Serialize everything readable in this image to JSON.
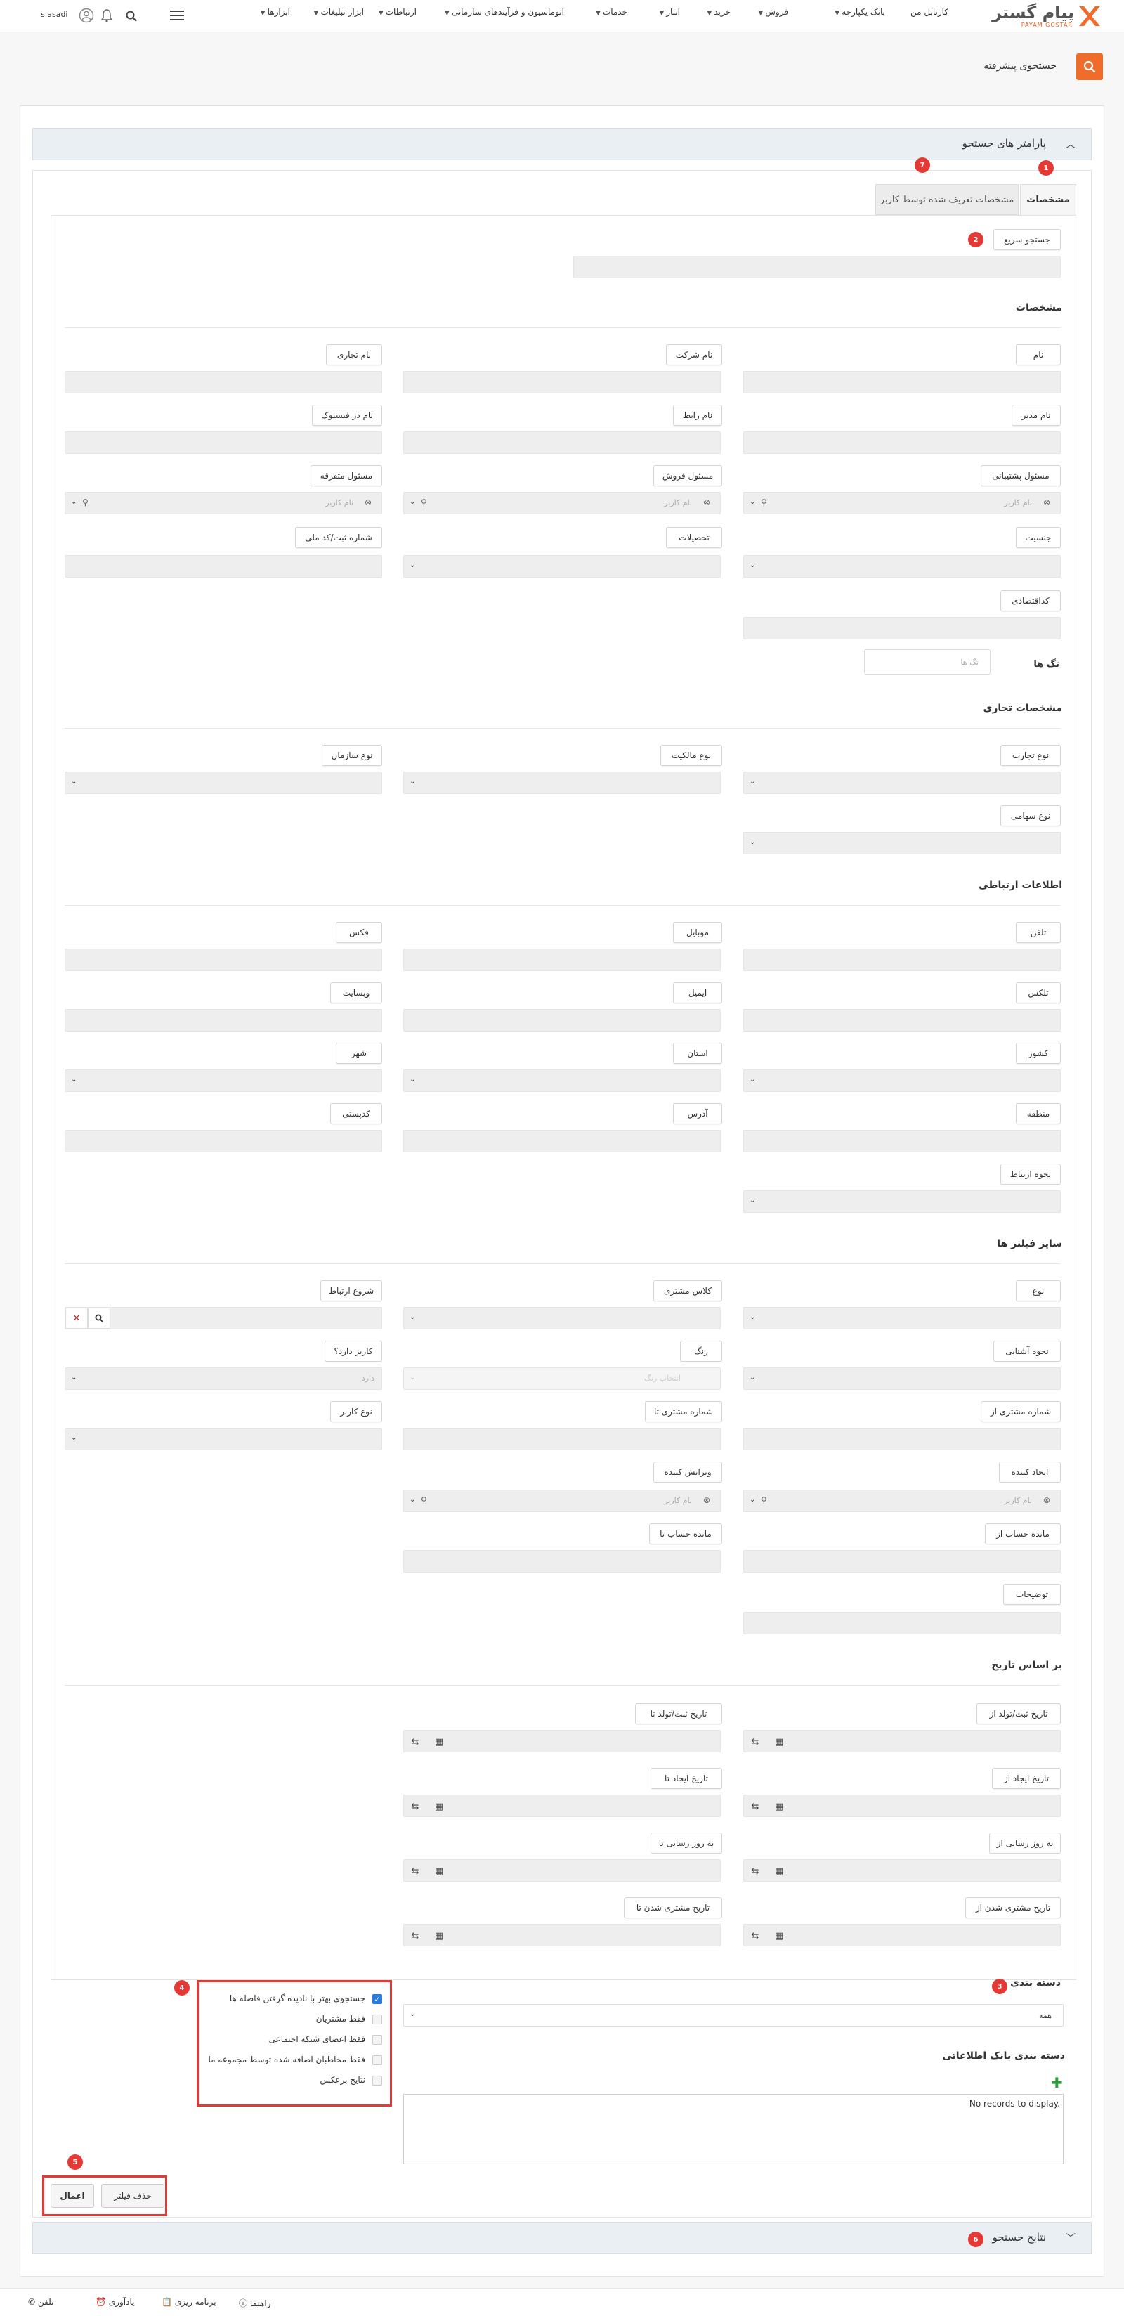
{
  "nav": {
    "brand": "پیام گستر",
    "brand_sub": "PAYAM GOSTAR",
    "menu": [
      "کارتابل من",
      "بانک یکپارچه",
      "فروش",
      "خرید",
      "انبار",
      "خدمات",
      "اتوماسیون و فرآیندهای سازمانی",
      "ارتباطات",
      "ابزار تبلیغات",
      "ابزارها"
    ],
    "username": "s.asadi"
  },
  "page": {
    "title": "جستجوی پیشرفته"
  },
  "panel": {
    "params_title": "پارامتر های جستجو",
    "results_title": "نتایج جستجو",
    "tabs": [
      "مشخصات",
      "مشخصات تعریف شده توسط کاربر"
    ]
  },
  "quick": {
    "label": "جستجو سریع"
  },
  "sections": {
    "specs": "مشخصات",
    "commercial": "مشخصات تجاری",
    "contact": "اطلاعات ارتباطی",
    "other": "سایر فیلتر ها",
    "date": "بر اساس تاریخ",
    "category": "دسته بندی",
    "db_category": "دسته بندی بانک اطلاعاتی"
  },
  "fields": {
    "name": "نام",
    "company": "نام شرکت",
    "trade_name": "نام تجاری",
    "manager": "نام مدیر",
    "liaison": "نام رابط",
    "facebook": "نام در فیسبوک",
    "support": "مسئول پشتیبانی",
    "sales": "مسئول فروش",
    "misc": "مسئول متفرقه",
    "gender": "جنسیت",
    "education": "تحصیلات",
    "reg_no": "شماره ثبت/کد ملی",
    "econ_code": "کداقتصادی",
    "tags": "تگ ها",
    "trade_type": "نوع تجارت",
    "ownership": "نوع مالکیت",
    "org_type": "نوع سازمان",
    "share_type": "نوع سهامی",
    "phone": "تلفن",
    "mobile": "موبایل",
    "fax": "فکس",
    "telex": "تلکس",
    "email": "ایمیل",
    "website": "وبسایت",
    "country": "کشور",
    "province": "استان",
    "city": "شهر",
    "region": "منطقه",
    "address": "آدرس",
    "postal": "کدپستی",
    "contact_method": "نحوه ارتباط",
    "type": "نوع",
    "cust_class": "کلاس مشتری",
    "start_contact": "شروع ارتباط",
    "acquaint": "نحوه آشنایی",
    "color": "رنگ",
    "has_user": "کاربر دارد؟",
    "cust_no_from": "شماره مشتری از",
    "cust_no_to": "شماره مشتری تا",
    "user_type": "نوع کاربر",
    "creator": "ایجاد کننده",
    "editor": "ویرایش کننده",
    "balance_from": "مانده حساب از",
    "balance_to": "مانده حساب تا",
    "notes": "توضیحات",
    "reg_from": "تاریخ ثبت/تولد از",
    "reg_to": "تاریخ ثبت/تولد تا",
    "create_from": "تاریخ ایجاد از",
    "create_to": "تاریخ ایجاد تا",
    "update_from": "به روز رسانی از",
    "update_to": "به روز رسانی تا",
    "cust_from": "تاریخ مشتری شدن از",
    "cust_to": "تاریخ مشتری شدن تا"
  },
  "placeholders": {
    "username": "نام کاربر",
    "tags": "تگ ها",
    "color": "انتخاب رنگ",
    "has_user": "دارد"
  },
  "category_value": "همه",
  "no_records": "No records to display.",
  "options": [
    {
      "label": "جستجوی بهتر با نادیده گرفتن فاصله ها",
      "checked": true
    },
    {
      "label": "فقط مشتریان",
      "checked": false
    },
    {
      "label": "فقط اعضای شبکه اجتماعی",
      "checked": false
    },
    {
      "label": "فقط مخاطبان اضافه شده توسط مجموعه ما",
      "checked": false
    },
    {
      "label": "نتایج برعکس",
      "checked": false
    }
  ],
  "buttons": {
    "remove_filter": "حذف فیلتر",
    "apply": "اعمال"
  },
  "badges": [
    "1",
    "2",
    "3",
    "4",
    "5",
    "6",
    "7"
  ],
  "bottom": {
    "phone": "تلفن",
    "reminder": "یادآوری",
    "planning": "برنامه ریزی",
    "help": "راهنما"
  },
  "colors": {
    "accent": "#ef6c2a",
    "highlight": "#e53935",
    "panel_header": "#eaeff4"
  }
}
